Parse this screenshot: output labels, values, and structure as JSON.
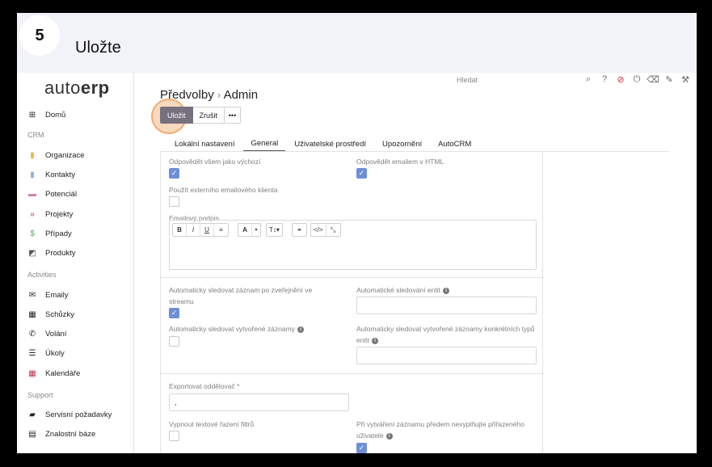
{
  "step": {
    "number": "5",
    "title": "Uložte"
  },
  "logo": {
    "prefix": "auto",
    "suffix": "erp"
  },
  "sidebar": {
    "home": "Domů",
    "sections": {
      "crm": "CRM",
      "activities": "Activities",
      "support": "Support"
    },
    "crm_items": [
      "Organizace",
      "Kontakty",
      "Potenciál",
      "Projekty",
      "Případy",
      "Produkty"
    ],
    "activity_items": [
      "Emaily",
      "Schůzky",
      "Volání",
      "Úkoly",
      "Kalendáře"
    ],
    "support_items": [
      "Servisní požadavky",
      "Znalostní báze"
    ],
    "colors": {
      "organizace": "#e8b84a",
      "kontakty": "#8fb0d9",
      "potencial": "#d080b0",
      "projekty": "#c0304a",
      "pripady": "#5aa860",
      "produkty": "#555555",
      "kalendar": "#c0304a"
    }
  },
  "header": {
    "breadcrumb_parent": "Předvolby",
    "breadcrumb_sep": "›",
    "breadcrumb_current": "Admin",
    "search_placeholder": "Hledat",
    "icons": [
      "search-icon",
      "help-icon",
      "blocked-icon",
      "power-icon",
      "eraser-icon",
      "brush-icon",
      "hammer-icon"
    ]
  },
  "toolbar": {
    "save": "Uložit",
    "cancel": "Zrušit",
    "more": "•••"
  },
  "tabs": [
    "Lokální nastavení",
    "General",
    "Uživatelské prostředí",
    "Upozornění",
    "AutoCRM"
  ],
  "form": {
    "reply_all_default": "Odpovědět všem jako výchozí",
    "reply_html": "Odpovědět emailem v HTML",
    "use_external_client": "Použít externího emailového klienta",
    "email_signature": "Emailový podpis",
    "editor_buttons": [
      "B",
      "I",
      "U",
      "≡",
      "A",
      "▾",
      "T↕▾",
      "⚭",
      "</>",
      "⤡"
    ],
    "auto_follow_posted": "Automaticky sledovat záznam po zveřejnění ve streamu",
    "auto_follow_entities": "Automatické sledování entit",
    "auto_follow_created": "Automaticky sledovat vytvořené záznamy",
    "auto_follow_created_types": "Automaticky sledovat vytvořené záznamy konkrétních typů entit",
    "export_delimiter": "Exportovat oddělovač *",
    "export_delimiter_value": ",",
    "disable_text_filter": "Vypnout textové řazení filtrů",
    "no_fill_assigned": "Při vytváření záznamu předem nevyplňujte přiřazeného uživatele"
  }
}
